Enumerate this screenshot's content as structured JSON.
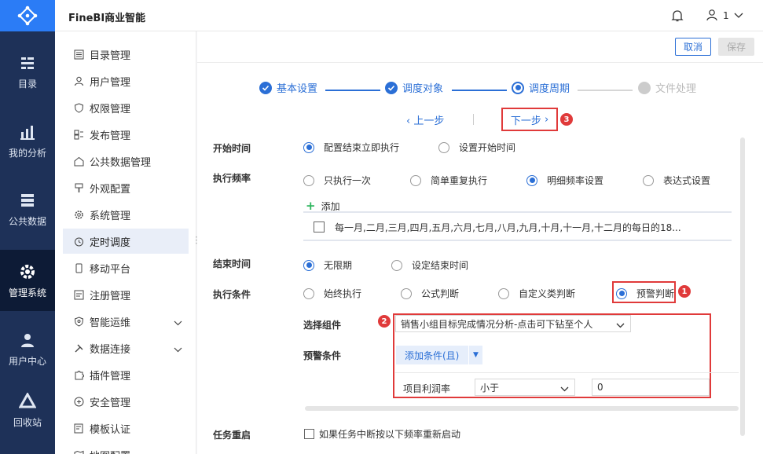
{
  "app": {
    "title": "FineBI商业智能",
    "user_name": "1"
  },
  "leftnav": [
    {
      "label": "目录",
      "icon": "catalog-icon"
    },
    {
      "label": "我的分析",
      "icon": "analysis-icon"
    },
    {
      "label": "公共数据",
      "icon": "public-data-icon"
    },
    {
      "label": "管理系统",
      "icon": "gear-icon"
    },
    {
      "label": "用户中心",
      "icon": "user-center-icon"
    },
    {
      "label": "回收站",
      "icon": "recycle-icon"
    }
  ],
  "submenu": [
    {
      "label": "目录管理"
    },
    {
      "label": "用户管理"
    },
    {
      "label": "权限管理"
    },
    {
      "label": "发布管理"
    },
    {
      "label": "公共数据管理"
    },
    {
      "label": "外观配置"
    },
    {
      "label": "系统管理"
    },
    {
      "label": "定时调度"
    },
    {
      "label": "移动平台"
    },
    {
      "label": "注册管理"
    },
    {
      "label": "智能运维"
    },
    {
      "label": "数据连接"
    },
    {
      "label": "插件管理"
    },
    {
      "label": "安全管理"
    },
    {
      "label": "模板认证"
    },
    {
      "label": "地图配置"
    }
  ],
  "toolbar": {
    "cancel": "取消",
    "save": "保存"
  },
  "steps": [
    {
      "label": "基本设置"
    },
    {
      "label": "调度对象"
    },
    {
      "label": "调度周期"
    },
    {
      "label": "文件处理"
    }
  ],
  "nav": {
    "prev": "上一步",
    "next": "下一步",
    "badge3": "3"
  },
  "form": {
    "start_time": {
      "label": "开始时间",
      "opt1": "配置结束立即执行",
      "opt2": "设置开始时间"
    },
    "frequency": {
      "label": "执行频率",
      "opt1": "只执行一次",
      "opt2": "简单重复执行",
      "opt3": "明细频率设置",
      "opt4": "表达式设置",
      "add": "添加",
      "item": "每一月,二月,三月,四月,五月,六月,七月,八月,九月,十月,十一月,十二月的每日的18..."
    },
    "end_time": {
      "label": "结束时间",
      "opt1": "无限期",
      "opt2": "设定结束时间"
    },
    "condition": {
      "label": "执行条件",
      "opt1": "始终执行",
      "opt2": "公式判断",
      "opt3": "自定义类判断",
      "opt4": "预警判断",
      "badge1": "1"
    },
    "component": {
      "label": "选择组件",
      "value": "销售小组目标完成情况分析-点击可下钻至个人",
      "badge2": "2"
    },
    "warning": {
      "label": "预警条件",
      "add_btn": "添加条件(且)",
      "field": "项目利润率",
      "operator": "小于",
      "value": "0"
    },
    "restart": {
      "label": "任务重启",
      "checkbox": "如果任务中断按以下频率重新启动"
    }
  }
}
